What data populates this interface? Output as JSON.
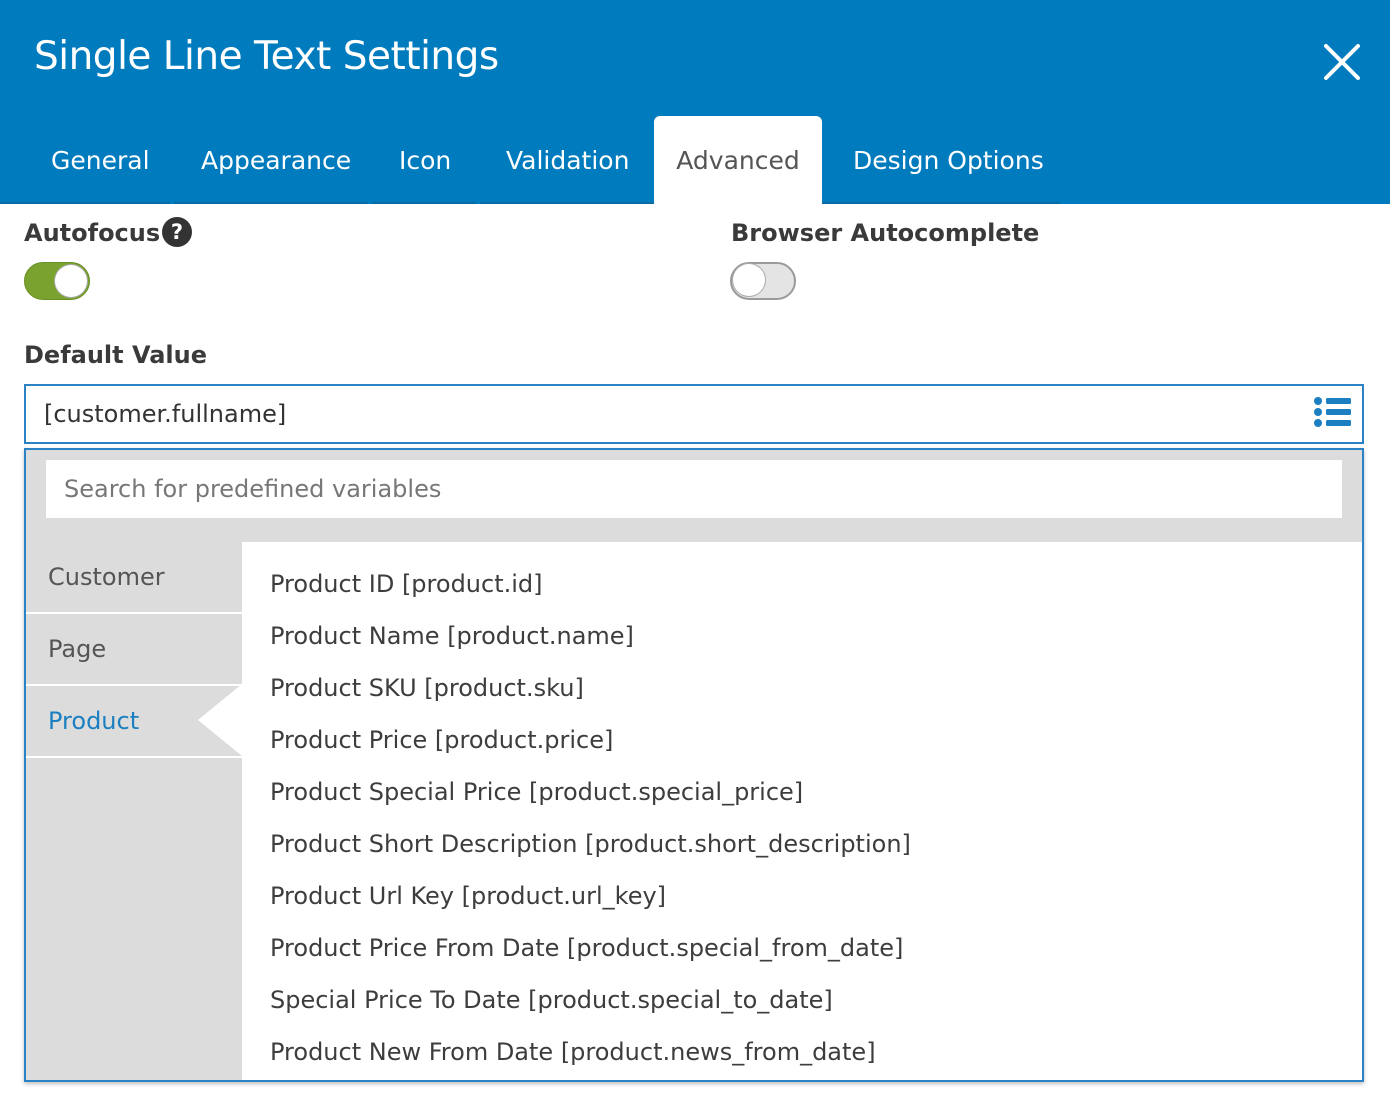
{
  "dialog": {
    "title": "Single Line Text Settings",
    "close_icon": "close-icon"
  },
  "tabs": [
    {
      "label": "General"
    },
    {
      "label": "Appearance"
    },
    {
      "label": "Icon"
    },
    {
      "label": "Validation"
    },
    {
      "label": "Advanced",
      "active": true
    },
    {
      "label": "Design Options"
    }
  ],
  "autofocus": {
    "label": "Autofocus",
    "help_icon": "question-circle-icon",
    "enabled": true
  },
  "browser_autocomplete": {
    "label": "Browser Autocomplete",
    "enabled": false
  },
  "default_value": {
    "label": "Default Value",
    "value": "[customer.fullname]",
    "variables_icon": "list-icon"
  },
  "variables_dropdown": {
    "search_placeholder": "Search for predefined variables",
    "categories": [
      {
        "label": "Customer"
      },
      {
        "label": "Page"
      },
      {
        "label": "Product",
        "active": true
      }
    ],
    "items": [
      "Product ID [product.id]",
      "Product Name [product.name]",
      "Product SKU [product.sku]",
      "Product Price [product.price]",
      "Product Special Price [product.special_price]",
      "Product Short Description [product.short_description]",
      "Product Url Key [product.url_key]",
      "Product Price From Date [product.special_from_date]",
      "Special Price To Date [product.special_to_date]",
      "Product New From Date [product.news_from_date]"
    ]
  },
  "colors": {
    "header": "#007bbd",
    "toggle_on": "#79a22e",
    "accent": "#1b7fc1"
  }
}
